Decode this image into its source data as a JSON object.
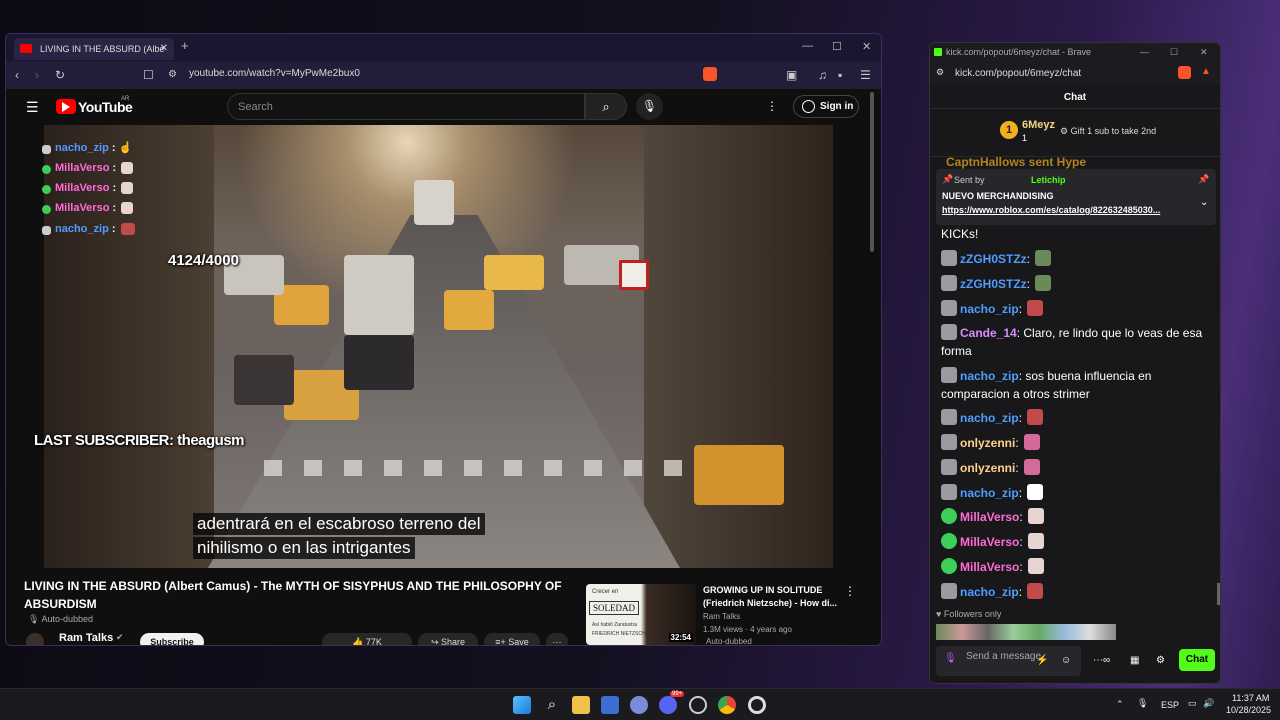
{
  "yt_window": {
    "tab_title": "LIVING IN THE ABSURD (Albe",
    "new_tab": "+",
    "url": "youtube.com/watch?v=MyPwMe2bux0",
    "search_placeholder": "Search",
    "logo": "YouTube",
    "logo_region": "AR",
    "sign_in": "Sign in",
    "stream_chat": [
      {
        "user": "nacho_zip",
        "color": "#4f9dff"
      },
      {
        "user": "MillaVerso",
        "color": "#ff6bd6"
      },
      {
        "user": "MillaVerso",
        "color": "#ff6bd6"
      },
      {
        "user": "MillaVerso",
        "color": "#ff6bd6"
      },
      {
        "user": "nacho_zip",
        "color": "#4f9dff"
      }
    ],
    "sub_goal": "4124/4000",
    "last_sub": "LAST SUBSCRIBER: theagusm",
    "subtitle_line1": "adentrará en el escabroso terreno del",
    "subtitle_line2": "nihilismo o en las intrigantes",
    "video_title": "LIVING IN THE ABSURD (Albert Camus) - The MYTH OF SISYPHUS AND THE PHILOSOPHY OF ABSURDISM",
    "auto_dubbed": "Auto-dubbed",
    "channel": "Ram Talks",
    "subscribe": "Subscribe",
    "likes": "77K",
    "share": "Share",
    "save": "Save",
    "side_video": {
      "thumb_top": "Crecer en",
      "thumb_tag": "SOLEDAD",
      "thumb_sub1": "Así habló Zaratustra",
      "thumb_sub2": "FRIEDRICH NIETZSCHE",
      "duration": "32:54",
      "title": "GROWING UP IN SOLITUDE (Friedrich Nietzsche) - How di...",
      "channel": "Ram Talks",
      "meta": "1.3M views · 4 years ago",
      "badge": "Auto-dubbed"
    }
  },
  "kick_window": {
    "title": "kick.com/popout/6meyz/chat - Brave",
    "url": "kick.com/popout/6meyz/chat",
    "header": "Chat",
    "leader_name": "6Meyz",
    "leader_count": "1",
    "gift_text": "Gift 1 sub to take 2nd",
    "ghost_line": "CaptnHallows sent Hype",
    "pinned_sent_by": "Sent by",
    "pinned_user": "Letichip",
    "pinned_title": "NUEVO MERCHANDISING",
    "pinned_link": "https://www.roblox.com/es/catalog/822632485030...",
    "messages": [
      {
        "user": "",
        "text": "KICKs!",
        "color": "#ffffff"
      },
      {
        "user": "zZGH0STZz",
        "text": "",
        "color": "#4f9dff"
      },
      {
        "user": "zZGH0STZz",
        "text": "",
        "color": "#4f9dff"
      },
      {
        "user": "nacho_zip",
        "text": "",
        "color": "#4f9dff"
      },
      {
        "user": "Cande_14",
        "text": "Claro, re lindo que lo veas de esa forma",
        "color": "#d58cff"
      },
      {
        "user": "nacho_zip",
        "text": "sos buena influencia en comparacion a otros strimer",
        "color": "#4f9dff"
      },
      {
        "user": "nacho_zip",
        "text": "",
        "color": "#4f9dff"
      },
      {
        "user": "onlyzenni",
        "text": "",
        "color": "#ffd38a"
      },
      {
        "user": "onlyzenni",
        "text": "",
        "color": "#ffd38a"
      },
      {
        "user": "nacho_zip",
        "text": "",
        "color": "#4f9dff"
      },
      {
        "user": "MillaVerso",
        "text": "",
        "color": "#ff6bd6"
      },
      {
        "user": "MillaVerso",
        "text": "",
        "color": "#ff6bd6"
      },
      {
        "user": "MillaVerso",
        "text": "",
        "color": "#ff6bd6"
      },
      {
        "user": "nacho_zip",
        "text": "",
        "color": "#4f9dff"
      }
    ],
    "followers_only": "Followers only",
    "input_placeholder": "Send a message",
    "chat_button": "Chat"
  },
  "taskbar": {
    "lang": "ESP",
    "time": "11:37 AM",
    "date": "10/28/2025",
    "badge_count": "99+"
  }
}
